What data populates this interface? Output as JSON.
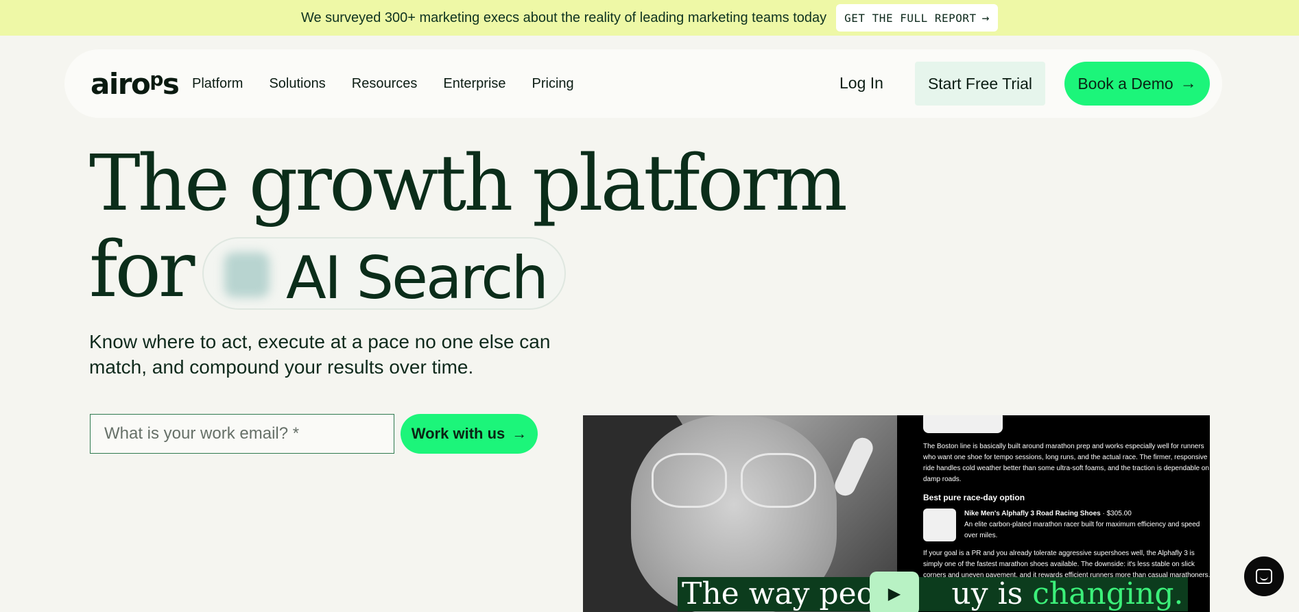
{
  "banner": {
    "text": "We surveyed 300+ marketing execs about the reality of leading marketing teams today",
    "cta_label": "GET THE FULL REPORT",
    "cta_icon": "→"
  },
  "nav": {
    "logo_main": "airo",
    "logo_sup": "p",
    "logo_tail": "s",
    "items": [
      "Platform",
      "Solutions",
      "Resources",
      "Enterprise",
      "Pricing"
    ],
    "login": "Log In",
    "trial": "Start Free Trial",
    "demo": "Book a Demo",
    "demo_icon": "→"
  },
  "hero": {
    "line1": "The growth platform",
    "for": "for",
    "rotating_word": "AI Search",
    "subtitle": "Know where to act, execute at a pace no one else can match, and compound your results over time."
  },
  "form": {
    "email_placeholder": "What is your work email? *",
    "submit_label": "Work with us",
    "submit_icon": "→"
  },
  "video": {
    "panel_p1": "The Boston line is basically built around marathon prep and works especially well for runners who want one shoe for tempo sessions, long runs, and the actual race. The firmer, responsive ride handles cold weather better than some ultra-soft foams, and the traction is dependable on damp roads.",
    "panel_heading": "Best pure race-day option",
    "product_title": "Nike Men's Alphafly 3 Road Racing Shoes",
    "product_price": "· $305.00",
    "product_desc": "An elite carbon-plated marathon racer built for maximum efficiency and speed over miles.",
    "panel_p3": "If your goal is a PR and you already tolerate aggressive supershoes well, the Alphafly 3 is simply one of the fastest marathon shoes available. The downside: it's less stable on slick corners and uneven pavement, and it rewards efficient runners more than casual marathoners.",
    "caption_start": "The way peopl",
    "caption_mid": "uy is ",
    "caption_highlight": "changing.",
    "play_icon": "▶"
  },
  "colors": {
    "banner_bg": "#eef8a6",
    "accent_green": "#1cf57a",
    "hero_text": "#0b2d1a",
    "page_bg": "#f5f5f0"
  }
}
